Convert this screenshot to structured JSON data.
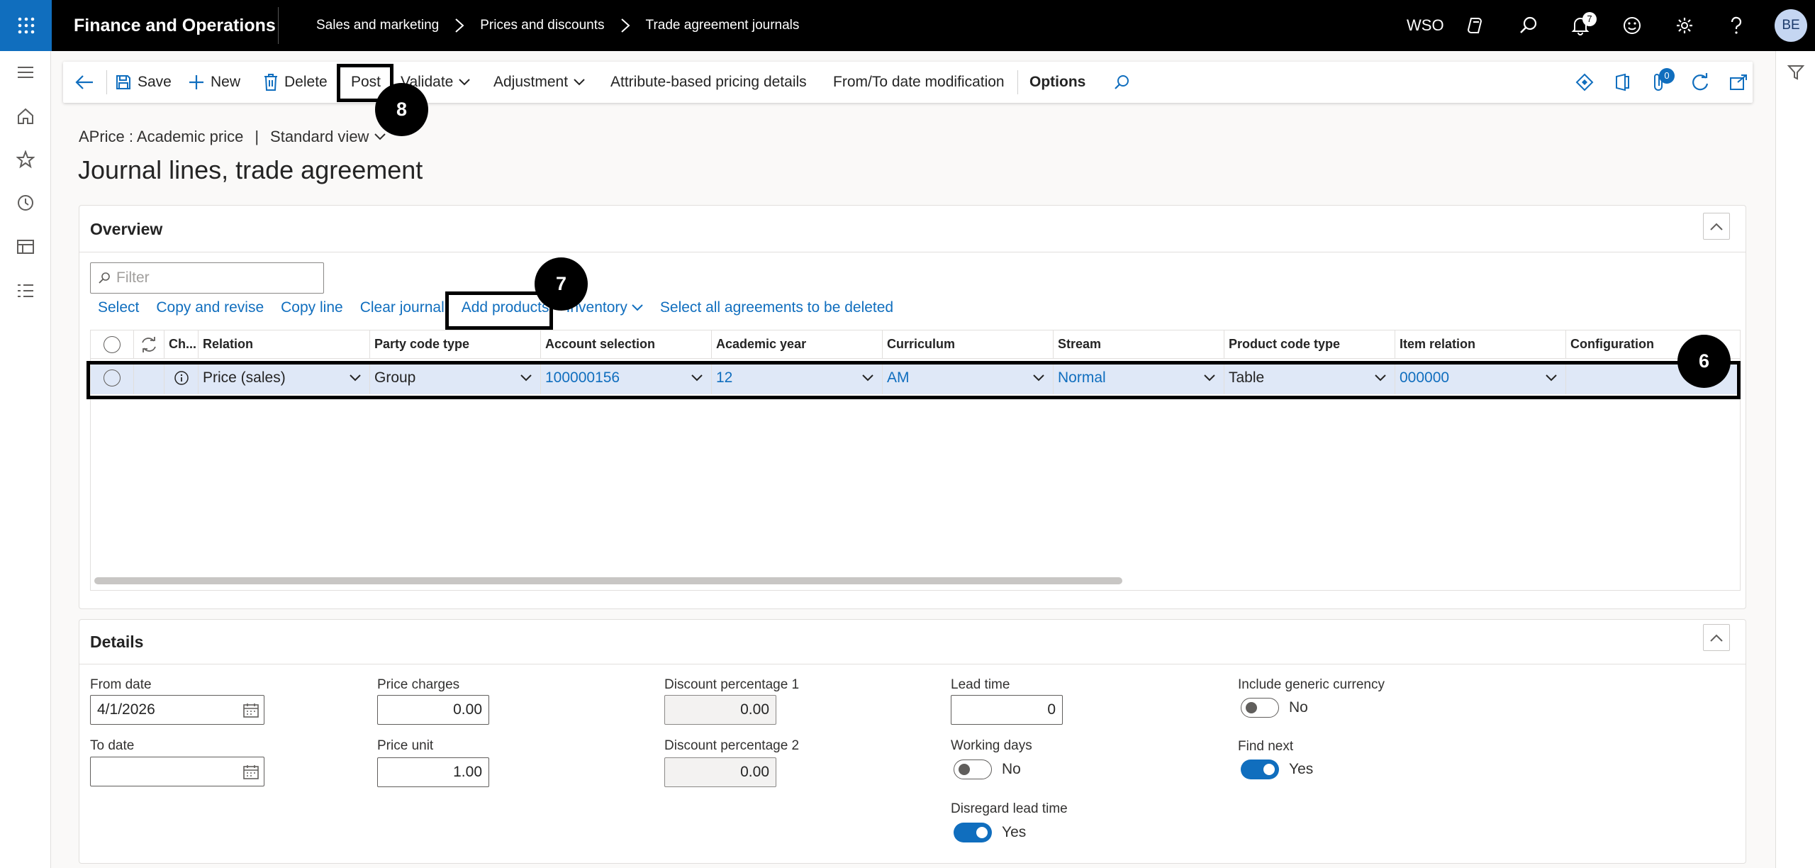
{
  "topbar": {
    "app_name": "Finance and Operations",
    "breadcrumbs": [
      "Sales and marketing",
      "Prices and discounts",
      "Trade agreement journals"
    ],
    "company": "WSO",
    "notification_count": "7",
    "avatar_initials": "BE"
  },
  "actions": {
    "save": "Save",
    "new": "New",
    "delete": "Delete",
    "post": "Post",
    "validate": "Validate",
    "adjustment": "Adjustment",
    "attribute_pricing": "Attribute-based pricing details",
    "date_modification": "From/To date modification",
    "options": "Options",
    "attachment_count": "0"
  },
  "callouts": {
    "post": "8",
    "add_products": "7",
    "row": "6"
  },
  "page": {
    "context": "APrice : Academic price",
    "context_sep": "|",
    "view": "Standard view",
    "title": "Journal lines, trade agreement"
  },
  "overview": {
    "title": "Overview",
    "filter_placeholder": "Filter",
    "grid_actions": [
      "Select",
      "Copy and revise",
      "Copy line",
      "Clear journal",
      "Add products",
      "Inventory",
      "Select all agreements to be deleted"
    ],
    "columns": [
      "Ch...",
      "Relation",
      "Party code type",
      "Account selection",
      "Academic year",
      "Curriculum",
      "Stream",
      "Product code type",
      "Item relation",
      "Configuration"
    ],
    "row": {
      "relation": "Price (sales)",
      "party_code_type": "Group",
      "account_selection": "100000156",
      "academic_year": "12",
      "curriculum": "AM",
      "stream": "Normal",
      "product_code_type": "Table",
      "item_relation": "000000",
      "configuration": ""
    }
  },
  "details": {
    "title": "Details",
    "from_date_label": "From date",
    "from_date": "4/1/2026",
    "to_date_label": "To date",
    "to_date": "",
    "price_charges_label": "Price charges",
    "price_charges": "0.00",
    "price_unit_label": "Price unit",
    "price_unit": "1.00",
    "discount1_label": "Discount percentage 1",
    "discount1": "0.00",
    "discount2_label": "Discount percentage 2",
    "discount2": "0.00",
    "lead_time_label": "Lead time",
    "lead_time": "0",
    "working_days_label": "Working days",
    "working_days": "No",
    "disregard_lead_time_label": "Disregard lead time",
    "disregard_lead_time": "Yes",
    "include_generic_currency_label": "Include generic currency",
    "include_generic_currency": "No",
    "find_next_label": "Find next",
    "find_next": "Yes"
  },
  "colors": {
    "accent": "#106ebe",
    "selected_row": "#dfe8f7",
    "topbar": "#000000"
  }
}
